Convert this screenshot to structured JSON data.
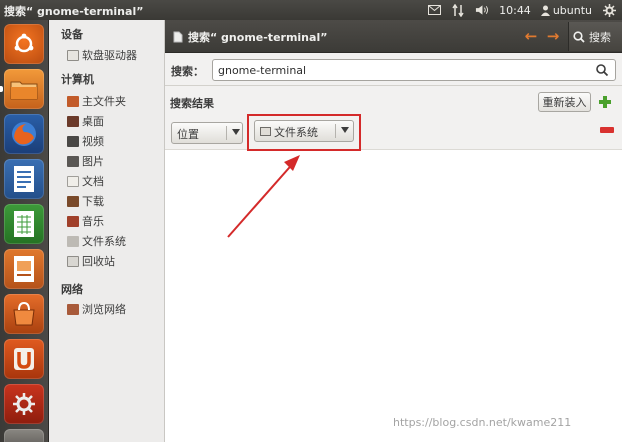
{
  "window": {
    "title": "搜索“ gnome-terminal”"
  },
  "tray": {
    "time": "10:44",
    "user": "ubuntu"
  },
  "sidebar": {
    "sections": [
      {
        "heading": "设备",
        "items": [
          {
            "label": "软盘驱动器",
            "icon": "floppy-icon"
          }
        ]
      },
      {
        "heading": "计算机",
        "items": [
          {
            "label": "主文件夹",
            "icon": "home-folder-icon"
          },
          {
            "label": "桌面",
            "icon": "desktop-icon"
          },
          {
            "label": "视频",
            "icon": "video-icon"
          },
          {
            "label": "图片",
            "icon": "pictures-icon"
          },
          {
            "label": "文档",
            "icon": "documents-icon"
          },
          {
            "label": "下载",
            "icon": "downloads-icon"
          },
          {
            "label": "音乐",
            "icon": "music-icon"
          },
          {
            "label": "文件系统",
            "icon": "filesystem-icon"
          },
          {
            "label": "回收站",
            "icon": "trash-icon"
          }
        ]
      },
      {
        "heading": "网络",
        "items": [
          {
            "label": "浏览网络",
            "icon": "network-icon"
          }
        ]
      }
    ]
  },
  "header": {
    "title": "搜索“ gnome-terminal”",
    "search_label": "搜索"
  },
  "search": {
    "label": "搜索：",
    "value": "gnome-terminal"
  },
  "results": {
    "label": "搜索结果",
    "reload_label": "重新装入",
    "location_combo": "位置",
    "filesystem_combo": "文件系统"
  },
  "watermark": "https://blog.csdn.net/kwame211",
  "colors": {
    "accent_orange": "#e07a30",
    "highlight_red": "#d42a2a",
    "add_green": "#4aa02c",
    "remove_red": "#d9322f"
  }
}
